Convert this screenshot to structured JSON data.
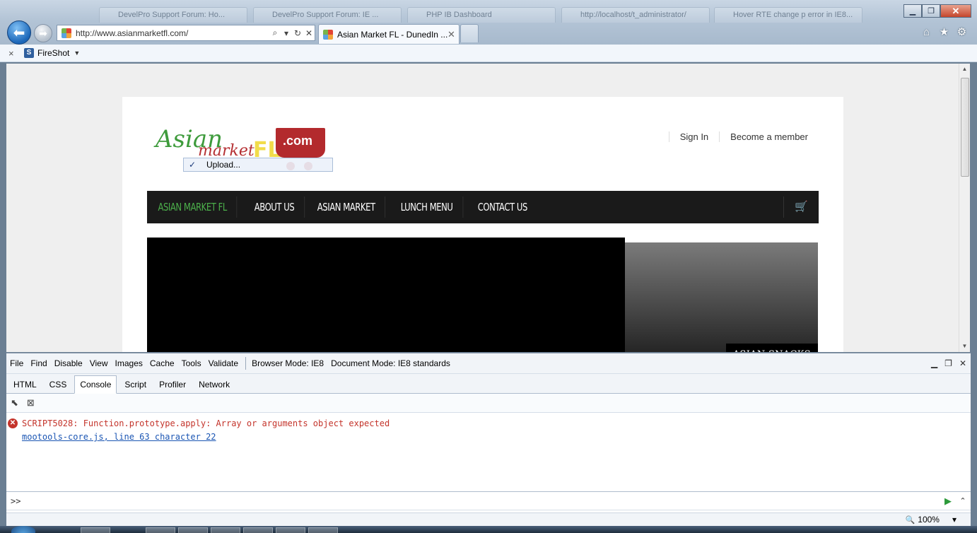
{
  "browser": {
    "background_tabs": [
      "DevelPro Support Forum: Ho...",
      "DevelPro Support Forum: IE ...",
      "PHP IB Dashboard",
      "http://localhost/t_administrator/",
      "Hover RTE change p error in IE8..."
    ],
    "address_url": "http://www.asianmarketfl.com/",
    "active_tab_title": "Asian Market FL - DunedIn ...",
    "command_bar": {
      "close": "×",
      "addon": "FireShot",
      "addon_icon_letter": "S"
    }
  },
  "site": {
    "logo": {
      "asian": "Asian",
      "market": "market",
      "fl": "FL",
      "dotcom": ".com"
    },
    "upload_label": "Upload...",
    "account_links": [
      "Sign In",
      "Become a member"
    ],
    "nav_items": [
      "ASIAN MARKET FL",
      "ABOUT US",
      "ASIAN MARKET",
      "LUNCH MENU",
      "CONTACT US"
    ],
    "slider_side_caption": "ASIAN SNACKS"
  },
  "devtools": {
    "menu": [
      "File",
      "Find",
      "Disable",
      "View",
      "Images",
      "Cache",
      "Tools",
      "Validate"
    ],
    "browser_mode": "Browser Mode: IE8",
    "document_mode": "Document Mode: IE8 standards",
    "tabs": [
      "HTML",
      "CSS",
      "Console",
      "Script",
      "Profiler",
      "Network"
    ],
    "active_tab": "Console",
    "error_message": "SCRIPT5028: Function.prototype.apply: Array or arguments object expected",
    "error_location": "mootools-core.js, line 63 character 22",
    "prompt": ">>"
  },
  "status": {
    "zoom": "100%"
  },
  "colors": {
    "nav_active": "#4cb04b",
    "error": "#c4342b",
    "link": "#1a55b3"
  }
}
